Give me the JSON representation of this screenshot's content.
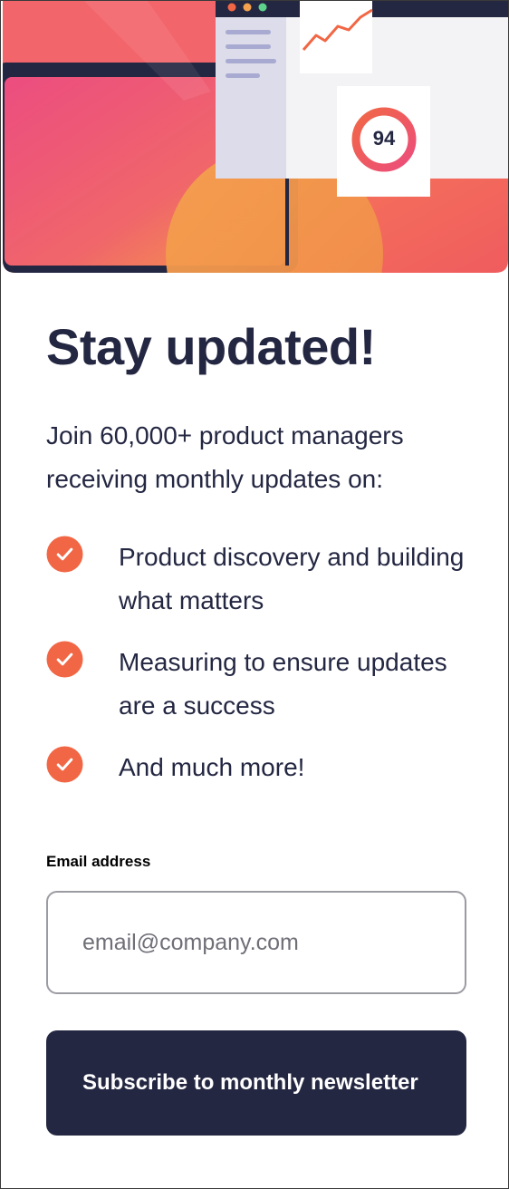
{
  "hero": {
    "illustration_name": "newsletter-illustration",
    "score_value": "94",
    "colors": {
      "gradient_pink": "#ec4d7c",
      "gradient_orange": "#ff6a3a",
      "dark": "#242742",
      "accent": "#f16745"
    }
  },
  "title": "Stay updated!",
  "intro": "Join 60,000+ product managers receiving monthly updates on:",
  "features": [
    {
      "icon": "check-circle-icon",
      "text": "Product discovery and building what matters"
    },
    {
      "icon": "check-circle-icon",
      "text": "Measuring to ensure updates are a success"
    },
    {
      "icon": "check-circle-icon",
      "text": "And much more!"
    }
  ],
  "form": {
    "email_label": "Email address",
    "email_placeholder": "email@company.com",
    "email_value": "",
    "submit_label": "Subscribe to monthly newsletter"
  },
  "colors": {
    "text_dark": "#242742",
    "accent_tomato": "#f16745",
    "button_bg": "#242742",
    "input_border": "#9b9ba3"
  }
}
